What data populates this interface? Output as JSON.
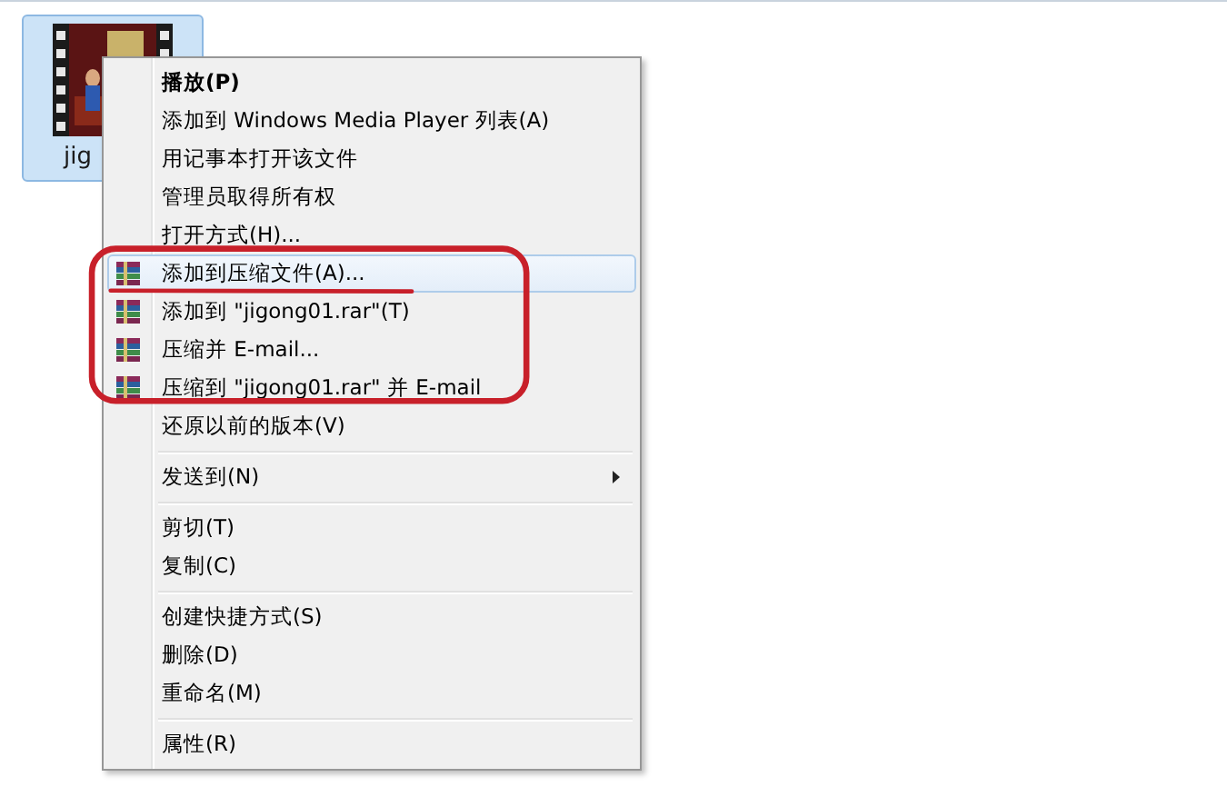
{
  "file": {
    "name": "jig",
    "selected": true
  },
  "menu": {
    "groups": [
      {
        "items": [
          {
            "label": "播放(P)",
            "kind": "plain",
            "default": true,
            "selected": false
          },
          {
            "label": "添加到 Windows Media Player 列表(A)",
            "kind": "plain",
            "default": false,
            "selected": false
          },
          {
            "label": "用记事本打开该文件",
            "kind": "plain",
            "default": false,
            "selected": false
          },
          {
            "label": "管理员取得所有权",
            "kind": "plain",
            "default": false,
            "selected": false
          },
          {
            "label": "打开方式(H)...",
            "kind": "plain",
            "default": false,
            "selected": false
          },
          {
            "label": "添加到压缩文件(A)...",
            "kind": "archive",
            "default": false,
            "selected": true
          },
          {
            "label": "添加到 \"jigong01.rar\"(T)",
            "kind": "archive",
            "default": false,
            "selected": false
          },
          {
            "label": "压缩并 E-mail...",
            "kind": "archive",
            "default": false,
            "selected": false
          },
          {
            "label": "压缩到 \"jigong01.rar\" 并 E-mail",
            "kind": "archive",
            "default": false,
            "selected": false
          },
          {
            "label": "还原以前的版本(V)",
            "kind": "plain",
            "default": false,
            "selected": false
          }
        ]
      },
      {
        "items": [
          {
            "label": "发送到(N)",
            "kind": "submenu",
            "default": false,
            "selected": false
          }
        ]
      },
      {
        "items": [
          {
            "label": "剪切(T)",
            "kind": "plain",
            "default": false,
            "selected": false
          },
          {
            "label": "复制(C)",
            "kind": "plain",
            "default": false,
            "selected": false
          }
        ]
      },
      {
        "items": [
          {
            "label": "创建快捷方式(S)",
            "kind": "plain",
            "default": false,
            "selected": false
          },
          {
            "label": "删除(D)",
            "kind": "plain",
            "default": false,
            "selected": false
          },
          {
            "label": "重命名(M)",
            "kind": "plain",
            "default": false,
            "selected": false
          }
        ]
      },
      {
        "items": [
          {
            "label": "属性(R)",
            "kind": "plain",
            "default": false,
            "selected": false
          }
        ]
      }
    ]
  }
}
